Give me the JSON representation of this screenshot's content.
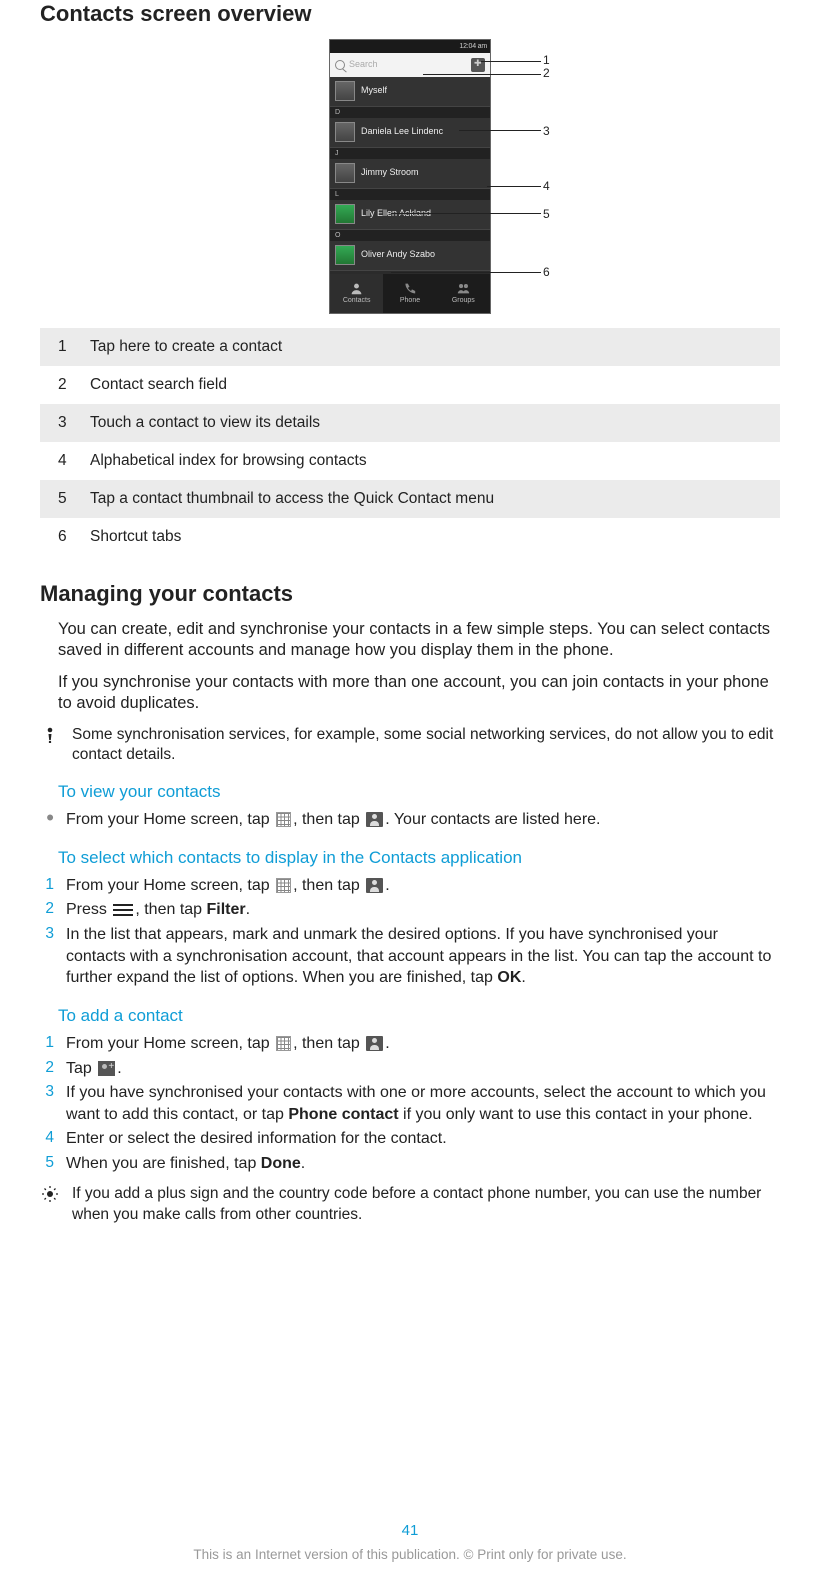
{
  "h1": "Contacts screen overview",
  "screenshot": {
    "time": "12:04 am",
    "search_placeholder": "Search",
    "contacts": [
      {
        "name": "Myself",
        "header": null
      },
      {
        "name": "Daniela Lee Lindenc",
        "header": "D"
      },
      {
        "name": "Jimmy Stroom",
        "header": "J"
      },
      {
        "name": "Lily Ellen Ackland",
        "header": "L"
      },
      {
        "name": "Oliver Andy Szabo",
        "header": "O"
      }
    ],
    "tabs": [
      "Contacts",
      "Phone",
      "Groups"
    ]
  },
  "callouts": [
    "1",
    "2",
    "3",
    "4",
    "5",
    "6"
  ],
  "legend": [
    {
      "n": "1",
      "t": "Tap here to create a contact"
    },
    {
      "n": "2",
      "t": "Contact search field"
    },
    {
      "n": "3",
      "t": "Touch a contact to view its details"
    },
    {
      "n": "4",
      "t": "Alphabetical index for browsing contacts"
    },
    {
      "n": "5",
      "t": "Tap a contact thumbnail to access the Quick Contact menu"
    },
    {
      "n": "6",
      "t": "Shortcut tabs"
    }
  ],
  "h2": "Managing your contacts",
  "p1": "You can create, edit and synchronise your contacts in a few simple steps. You can select contacts saved in different accounts and manage how you display them in the phone.",
  "p2": "If you synchronise your contacts with more than one account, you can join contacts in your phone to avoid duplicates.",
  "note1": "Some synchronisation services, for example, some social networking services, do not allow you to edit contact details.",
  "sub1": "To view your contacts",
  "view_step": {
    "pre": "From your Home screen, tap ",
    "mid": ", then tap ",
    "post": ". Your contacts are listed here."
  },
  "sub2": "To select which contacts to display in the Contacts application",
  "select_steps": {
    "s1": {
      "pre": "From your Home screen, tap ",
      "mid": ", then tap ",
      "post": "."
    },
    "s2": {
      "pre": "Press ",
      "mid": ", then tap ",
      "bold": "Filter",
      "post": "."
    },
    "s3": {
      "pre": "In the list that appears, mark and unmark the desired options. If you have synchronised your contacts with a synchronisation account, that account appears in the list. You can tap the account to further expand the list of options. When you are finished, tap ",
      "bold": "OK",
      "post": "."
    }
  },
  "sub3": "To add a contact",
  "add_steps": {
    "s1": {
      "pre": "From your Home screen, tap ",
      "mid": ", then tap ",
      "post": "."
    },
    "s2": {
      "pre": "Tap ",
      "post": "."
    },
    "s3": {
      "pre": "If you have synchronised your contacts with one or more accounts, select the account to which you want to add this contact, or tap ",
      "bold": "Phone contact",
      "post": " if you only want to use this contact in your phone."
    },
    "s4": "Enter or select the desired information for the contact.",
    "s5": {
      "pre": "When you are finished, tap ",
      "bold": "Done",
      "post": "."
    }
  },
  "tip": "If you add a plus sign and the country code before a contact phone number, you can use the number when you make calls from other countries.",
  "pagenum": "41",
  "footer": "This is an Internet version of this publication. © Print only for private use."
}
